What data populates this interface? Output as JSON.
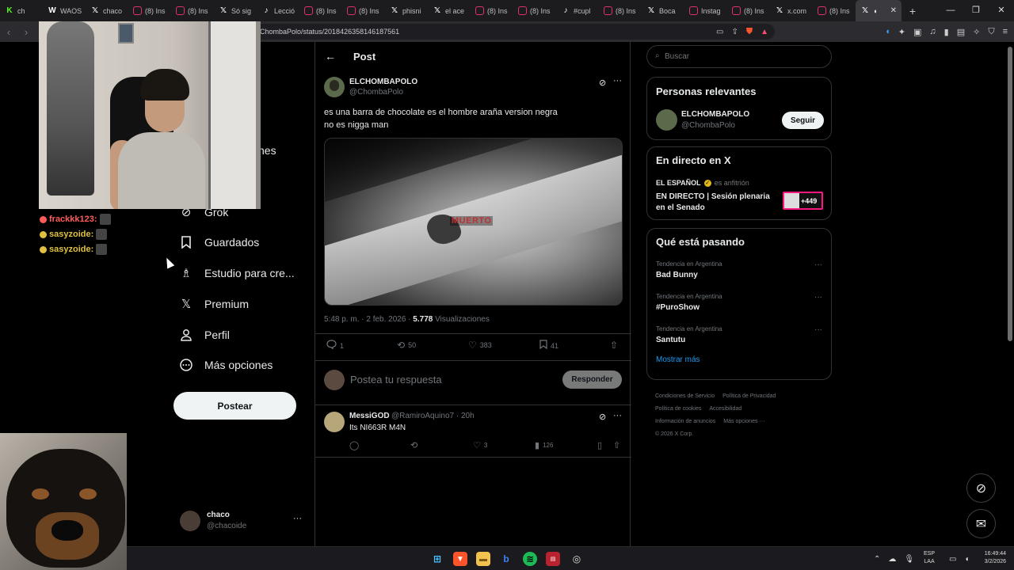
{
  "browser": {
    "tabs": [
      {
        "favicon": "kick-icon",
        "title": "ch"
      },
      {
        "favicon": "w-icon",
        "title": "WAOS"
      },
      {
        "favicon": "x-icon",
        "title": "chaco"
      },
      {
        "favicon": "instagram-icon",
        "title": "(8) Ins"
      },
      {
        "favicon": "instagram-icon",
        "title": "(8) Ins"
      },
      {
        "favicon": "x-icon",
        "title": "Só sig"
      },
      {
        "favicon": "tiktok-icon",
        "title": "Lecció"
      },
      {
        "favicon": "instagram-icon",
        "title": "(8) Ins"
      },
      {
        "favicon": "instagram-icon",
        "title": "(8) Ins"
      },
      {
        "favicon": "x-icon",
        "title": "phisni"
      },
      {
        "favicon": "x-icon",
        "title": "el ace"
      },
      {
        "favicon": "instagram-icon",
        "title": "(8) Ins"
      },
      {
        "favicon": "instagram-icon",
        "title": "(8) Ins"
      },
      {
        "favicon": "tiktok-icon",
        "title": "#cupl"
      },
      {
        "favicon": "instagram-icon",
        "title": "(8) Ins"
      },
      {
        "favicon": "x-icon",
        "title": "Boca"
      },
      {
        "favicon": "instagram-icon",
        "title": "Instag"
      },
      {
        "favicon": "instagram-icon",
        "title": "(8) Ins"
      },
      {
        "favicon": "x-icon",
        "title": "x.com"
      },
      {
        "favicon": "instagram-icon",
        "title": "(8) Ins"
      }
    ],
    "url": "ChombaPolo/status/2018426358146187561"
  },
  "sidebar": {
    "partial_label": "nes",
    "items": [
      {
        "label": "Grok",
        "icon": "grok-icon"
      },
      {
        "label": "Guardados",
        "icon": "bookmark-icon"
      },
      {
        "label": "Estudio para cre...",
        "icon": "studio-icon"
      },
      {
        "label": "Premium",
        "icon": "x-logo-icon"
      },
      {
        "label": "Perfil",
        "icon": "profile-icon"
      },
      {
        "label": "Más opciones",
        "icon": "more-circle-icon"
      }
    ],
    "post_button": "Postear",
    "account": {
      "name": "chaco",
      "handle": "@chacoide"
    }
  },
  "post": {
    "header_title": "Post",
    "author_name": "ELCHOMBAPOLO",
    "author_handle": "@ChombaPolo",
    "text_line1": "es una barra de chocolate es el hombre araña version negra",
    "text_line2": "no es nigga man",
    "media_overlay_text": "MUERTO",
    "timestamp": "5:48 p. m. · 2 feb. 2026 · ",
    "views_count": "5.778",
    "views_label": " Visualizaciones",
    "stats": {
      "replies": "1",
      "reposts": "50",
      "likes": "383",
      "bookmarks": "41"
    },
    "reply_placeholder": "Postea tu respuesta",
    "reply_button": "Responder"
  },
  "comment": {
    "name": "MessiGOD",
    "handle": "@RamiroAquino7 · 20h",
    "text": "Its NI663R M4N",
    "stats": {
      "likes": "3",
      "views": "126"
    }
  },
  "right": {
    "search_placeholder": "Buscar",
    "relevant_title": "Personas relevantes",
    "relevant_name": "ELCHOMBAPOLO",
    "relevant_handle": "@ChombaPolo",
    "follow_label": "Seguir",
    "live_title": "En directo en X",
    "live_source": "EL ESPAÑOL",
    "live_host_label": "es anfitrión",
    "live_event": "EN DIRECTO | Sesión plenaria en el Senado",
    "live_count": "+449",
    "trends_title": "Qué está pasando",
    "trends": [
      {
        "context": "Tendencia en Argentina",
        "name": "Bad Bunny"
      },
      {
        "context": "Tendencia en Argentina",
        "name": "#PuroShow"
      },
      {
        "context": "Tendencia en Argentina",
        "name": "Santutu"
      }
    ],
    "show_more": "Mostrar más",
    "footer": {
      "l1a": "Condiciones de Servicio",
      "l1b": "Política de Privacidad",
      "l2a": "Política de cookies",
      "l2b": "Accesibilidad",
      "l3a": "Información de anuncios",
      "l3b": "Más opciones ···",
      "l4": "© 2026 X Corp."
    }
  },
  "chat": [
    {
      "user": "frackkk123:",
      "color": "#ff5a5a"
    },
    {
      "user": "sasyzoide:",
      "color": "#e0c040"
    },
    {
      "user": "sasyzoide:",
      "color": "#e0c040"
    }
  ],
  "taskbar": {
    "lang_top": "ESP",
    "lang_bottom": "LAA",
    "time": "16:49:44",
    "date": "3/2/2026"
  },
  "colors": {
    "accent": "#1d9bf0",
    "live_border": "#f91880"
  }
}
